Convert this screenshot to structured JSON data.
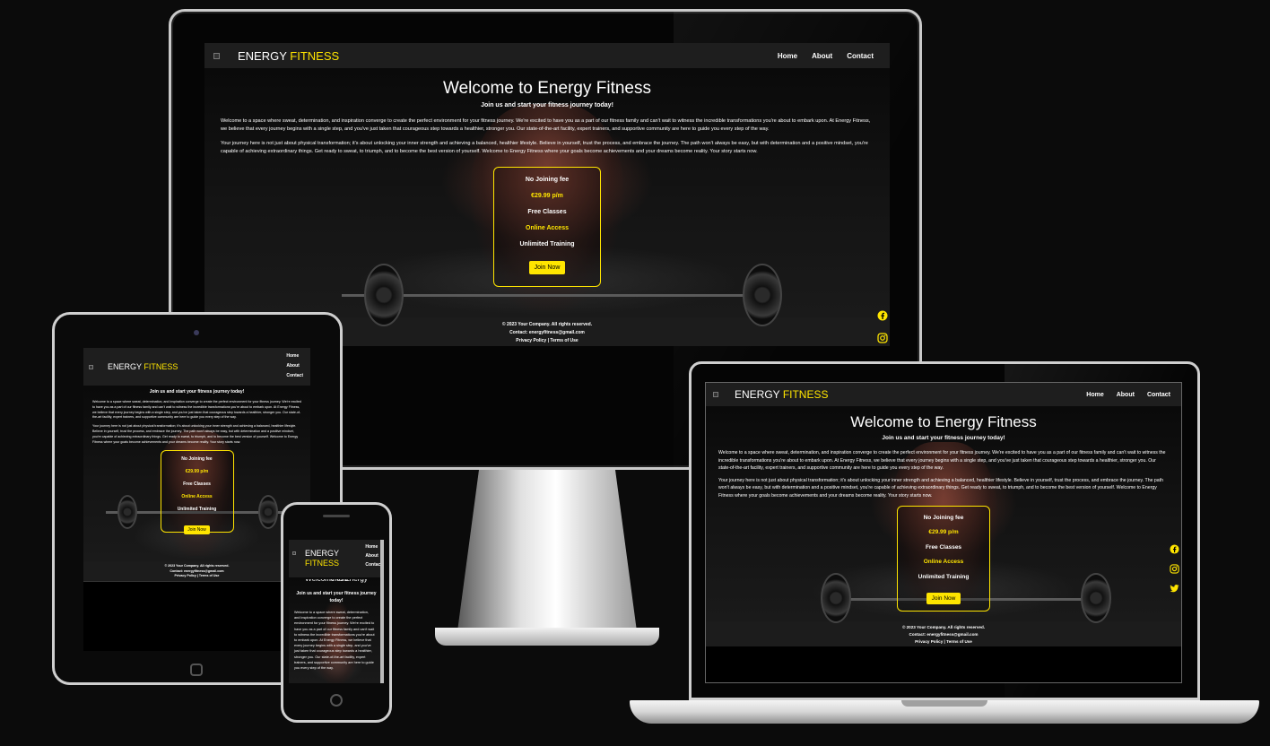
{
  "site": {
    "brand_main": "ENERGY",
    "brand_accent": "FITNESS",
    "nav": [
      "Home",
      "About",
      "Contact"
    ],
    "title": "Welcome to Energy Fitness",
    "subtitle": "Join us and start your fitness journey today!",
    "para1": "Welcome to a space where sweat, determination, and inspiration converge to create the perfect environment for your fitness journey. We're excited to have you as a part of our fitness family and can't wait to witness the incredible transformations you're about to embark upon. At Energy Fitness, we believe that every journey begins with a single step, and you've just taken that courageous step towards a healthier, stronger you. Our state-of-the-art facility, expert trainers, and supportive community are here to guide you every step of the way.",
    "para2": "Your journey here is not just about physical transformation; it's about unlocking your inner strength and achieving a balanced, healthier lifestyle. Believe in yourself, trust the process, and embrace the journey. The path won't always be easy, but with determination and a positive mindset, you're capable of achieving extraordinary things. Get ready to sweat, to triumph, and to become the best version of yourself. Welcome to Energy Fitness where your goals become achievements and your dreams become reality. Your story starts now.",
    "membership": {
      "joining_fee": "No Joining fee",
      "price": "€29.99 p/m",
      "classes": "Free Classes",
      "access": "Online Access",
      "training": "Unlimited Training",
      "button": "Join Now"
    },
    "footer": {
      "copyright": "© 2023 Your Company. All rights reserved.",
      "contact": "Contact: energyfitness@gmail.com",
      "links": "Privacy Policy | Terms of Use"
    },
    "social_icons": [
      "facebook-icon",
      "instagram-icon",
      "twitter-icon"
    ],
    "colors": {
      "accent": "#ffe500",
      "background": "#000000",
      "nav": "#1e1e1e"
    }
  }
}
